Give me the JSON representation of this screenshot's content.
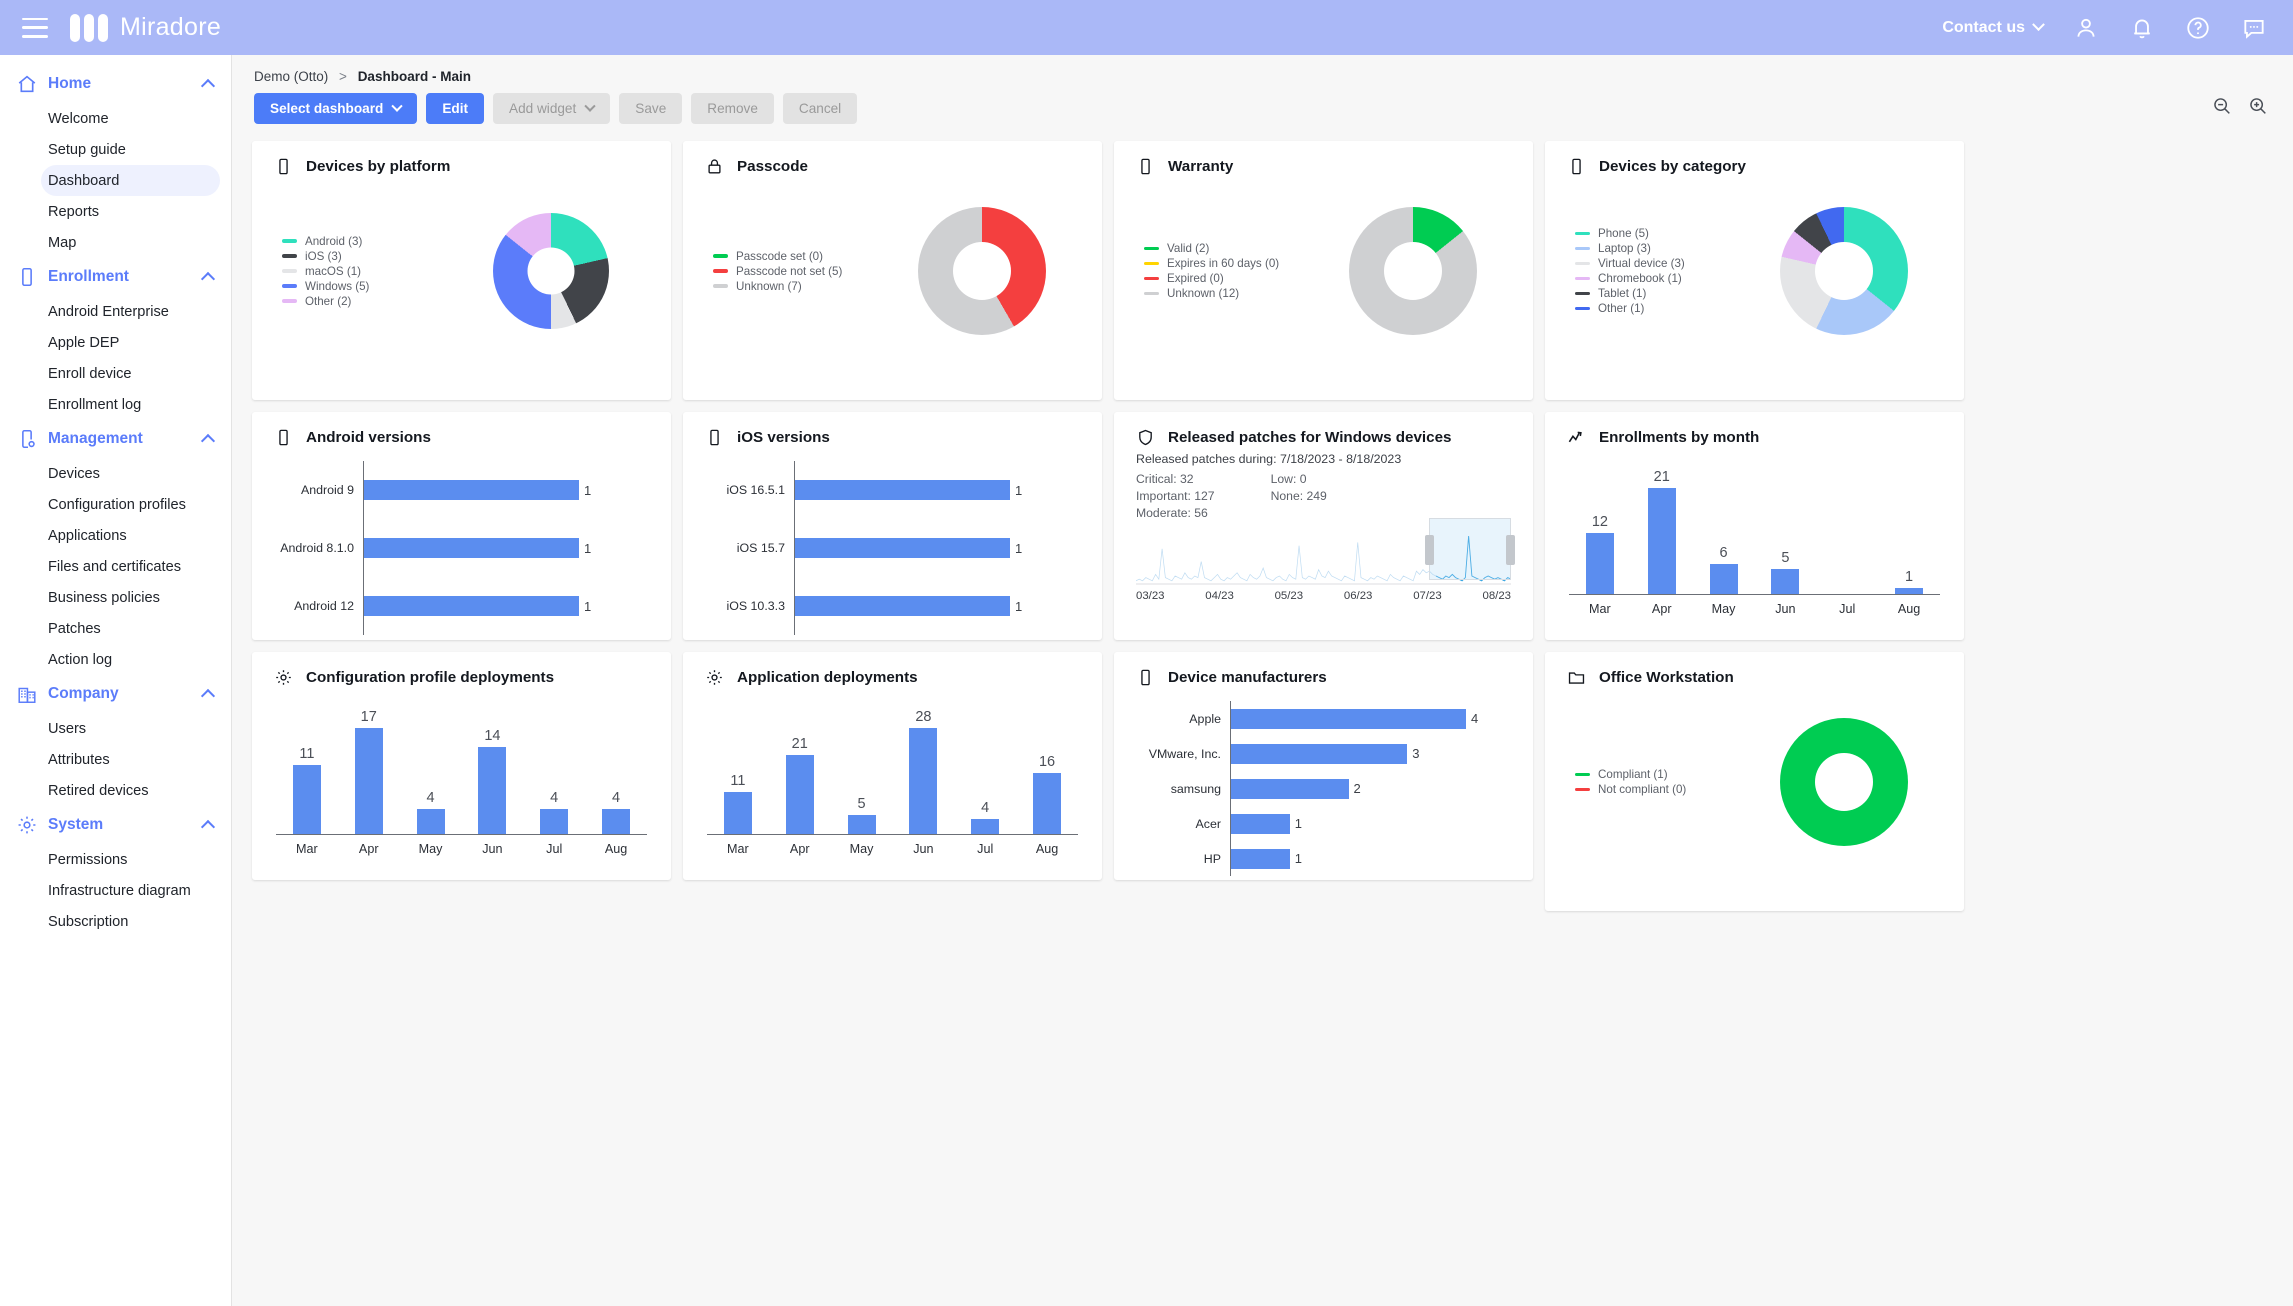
{
  "header": {
    "brand": "Miradore",
    "contact_label": "Contact us",
    "icons": [
      "menu-icon",
      "account-icon",
      "notifications-icon",
      "help-icon",
      "chat-icon"
    ]
  },
  "sidebar": {
    "groups": [
      {
        "label": "Home",
        "icon": "home-icon",
        "items": [
          {
            "label": "Welcome",
            "active": false
          },
          {
            "label": "Setup guide",
            "active": false
          },
          {
            "label": "Dashboard",
            "active": true
          },
          {
            "label": "Reports",
            "active": false
          },
          {
            "label": "Map",
            "active": false
          }
        ]
      },
      {
        "label": "Enrollment",
        "icon": "device-icon",
        "items": [
          {
            "label": "Android Enterprise",
            "active": false
          },
          {
            "label": "Apple DEP",
            "active": false
          },
          {
            "label": "Enroll device",
            "active": false
          },
          {
            "label": "Enrollment log",
            "active": false
          }
        ]
      },
      {
        "label": "Management",
        "icon": "device-settings-icon",
        "items": [
          {
            "label": "Devices",
            "active": false
          },
          {
            "label": "Configuration profiles",
            "active": false
          },
          {
            "label": "Applications",
            "active": false
          },
          {
            "label": "Files and certificates",
            "active": false
          },
          {
            "label": "Business policies",
            "active": false
          },
          {
            "label": "Patches",
            "active": false
          },
          {
            "label": "Action log",
            "active": false
          }
        ]
      },
      {
        "label": "Company",
        "icon": "building-icon",
        "items": [
          {
            "label": "Users",
            "active": false
          },
          {
            "label": "Attributes",
            "active": false
          },
          {
            "label": "Retired devices",
            "active": false
          }
        ]
      },
      {
        "label": "System",
        "icon": "gear-icon",
        "items": [
          {
            "label": "Permissions",
            "active": false
          },
          {
            "label": "Infrastructure diagram",
            "active": false
          },
          {
            "label": "Subscription",
            "active": false
          }
        ]
      }
    ]
  },
  "breadcrumb": {
    "root": "Demo (Otto)",
    "separator": ">",
    "current": "Dashboard - Main"
  },
  "toolbar": {
    "select_dashboard": "Select dashboard",
    "edit": "Edit",
    "add_widget": "Add widget",
    "save": "Save",
    "remove": "Remove",
    "cancel": "Cancel"
  },
  "zoom_controls": {
    "out": "zoom-out-icon",
    "in": "zoom-in-icon"
  },
  "colors": {
    "accent": "#4c7cf8",
    "bar": "#5b8def",
    "teal": "#2fe0bd",
    "dark_gray": "#414449",
    "light_gray": "#e4e5e7",
    "blue": "#5b7cfa",
    "purple": "#e5b8f5",
    "green": "#00cc52",
    "red": "#f43f3f",
    "yellow": "#ffd400",
    "gray": "#cfd0d2",
    "light_blue": "#a9c8f9",
    "header_bg": "#aab8f7"
  },
  "chart_data": [
    {
      "id": "devices-by-platform",
      "type": "pie",
      "title": "Devices by platform",
      "icon": "device-icon",
      "labels": [
        "Android (3)",
        "iOS (3)",
        "macOS (1)",
        "Windows (5)",
        "Other (2)"
      ],
      "categories": [
        "Android",
        "iOS",
        "macOS",
        "Windows",
        "Other"
      ],
      "values": [
        3,
        3,
        1,
        5,
        2
      ],
      "colors": [
        "#2fe0bd",
        "#414449",
        "#e4e5e7",
        "#5b7cfa",
        "#e5b8f5"
      ],
      "legend": "left"
    },
    {
      "id": "passcode",
      "type": "pie",
      "title": "Passcode",
      "icon": "lock-icon",
      "labels": [
        "Passcode set (0)",
        "Passcode not set (5)",
        "Unknown (7)"
      ],
      "categories": [
        "Passcode set",
        "Passcode not set",
        "Unknown"
      ],
      "values": [
        0,
        5,
        7
      ],
      "colors": [
        "#00cc52",
        "#f43f3f",
        "#cfd0d2"
      ],
      "legend": "left"
    },
    {
      "id": "warranty",
      "type": "pie",
      "title": "Warranty",
      "icon": "device-icon",
      "labels": [
        "Valid (2)",
        "Expires in 60 days (0)",
        "Expired (0)",
        "Unknown (12)"
      ],
      "categories": [
        "Valid",
        "Expires in 60 days",
        "Expired",
        "Unknown"
      ],
      "values": [
        2,
        0,
        0,
        12
      ],
      "colors": [
        "#00cc52",
        "#ffd400",
        "#f43f3f",
        "#cfd0d2"
      ],
      "legend": "left"
    },
    {
      "id": "devices-by-category",
      "type": "pie",
      "title": "Devices by category",
      "icon": "device-icon",
      "labels": [
        "Phone (5)",
        "Laptop (3)",
        "Virtual device (3)",
        "Chromebook (1)",
        "Tablet (1)",
        "Other (1)"
      ],
      "categories": [
        "Phone",
        "Laptop",
        "Virtual device",
        "Chromebook",
        "Tablet",
        "Other"
      ],
      "values": [
        5,
        3,
        3,
        1,
        1,
        1
      ],
      "colors": [
        "#2fe0bd",
        "#a9c8f9",
        "#e4e5e7",
        "#e5b8f5",
        "#414449",
        "#4169f0"
      ],
      "legend": "left"
    },
    {
      "id": "android-versions",
      "type": "bar",
      "orientation": "horizontal",
      "title": "Android versions",
      "icon": "device-icon",
      "categories": [
        "Android 9",
        "Android 8.1.0",
        "Android 12"
      ],
      "values": [
        1,
        1,
        1
      ],
      "xlim": [
        0,
        1
      ]
    },
    {
      "id": "ios-versions",
      "type": "bar",
      "orientation": "horizontal",
      "title": "iOS versions",
      "icon": "device-icon",
      "categories": [
        "iOS 16.5.1",
        "iOS 15.7",
        "iOS 10.3.3"
      ],
      "values": [
        1,
        1,
        1
      ],
      "xlim": [
        0,
        1
      ]
    },
    {
      "id": "released-patches",
      "type": "line",
      "title": "Released patches for Windows devices",
      "icon": "shield-icon",
      "subtitle": "Released patches during: 7/18/2023 - 8/18/2023",
      "stats": [
        {
          "label": "Critical: 32"
        },
        {
          "label": "Important: 127"
        },
        {
          "label": "Moderate: 56"
        },
        {
          "label": "Low: 0"
        },
        {
          "label": "None: 249"
        }
      ],
      "stats_left": [
        "Critical: 32",
        "Important: 127",
        "Moderate: 56"
      ],
      "stats_right": [
        "Low: 0",
        "None: 249"
      ],
      "tick_labels": [
        "03/23",
        "04/23",
        "05/23",
        "06/23",
        "07/23",
        "08/23"
      ],
      "brush_selected": true
    },
    {
      "id": "enrollments-by-month",
      "type": "bar",
      "orientation": "vertical",
      "title": "Enrollments by month",
      "icon": "trend-icon",
      "categories": [
        "Mar",
        "Apr",
        "May",
        "Jun",
        "Jul",
        "Aug"
      ],
      "values": [
        12,
        21,
        6,
        5,
        0,
        1
      ],
      "ylim": [
        0,
        21
      ]
    },
    {
      "id": "configuration-profile-deployments",
      "type": "bar",
      "orientation": "vertical",
      "title": "Configuration profile deployments",
      "icon": "gear-icon",
      "categories": [
        "Mar",
        "Apr",
        "May",
        "Jun",
        "Jul",
        "Aug"
      ],
      "values": [
        11,
        17,
        4,
        14,
        4,
        4
      ],
      "ylim": [
        0,
        17
      ]
    },
    {
      "id": "application-deployments",
      "type": "bar",
      "orientation": "vertical",
      "title": "Application deployments",
      "icon": "gear-icon",
      "categories": [
        "Mar",
        "Apr",
        "May",
        "Jun",
        "Jul",
        "Aug"
      ],
      "values": [
        11,
        21,
        5,
        28,
        4,
        16
      ],
      "ylim": [
        0,
        28
      ]
    },
    {
      "id": "device-manufacturers",
      "type": "bar",
      "orientation": "horizontal",
      "title": "Device manufacturers",
      "icon": "device-icon",
      "categories": [
        "Apple",
        "VMware, Inc.",
        "samsung",
        "Acer",
        "HP"
      ],
      "values": [
        4,
        3,
        2,
        1,
        1
      ],
      "xlim": [
        0,
        4
      ]
    },
    {
      "id": "office-workstation",
      "type": "pie",
      "title": "Office Workstation",
      "icon": "folder-icon",
      "labels": [
        "Compliant (1)",
        "Not compliant (0)"
      ],
      "categories": [
        "Compliant",
        "Not compliant"
      ],
      "values": [
        1,
        0
      ],
      "colors": [
        "#00cc52",
        "#f43f3f"
      ],
      "legend": "left"
    }
  ]
}
